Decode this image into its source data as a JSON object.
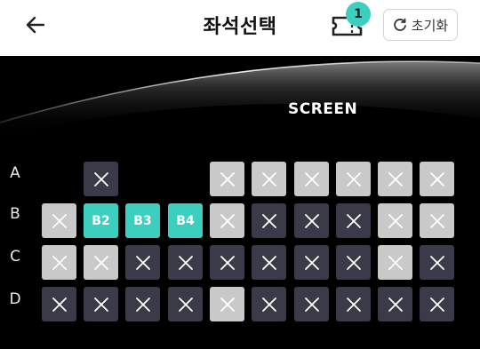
{
  "header": {
    "title": "좌석선택",
    "ticket_count": "1",
    "reset_label": "초기화"
  },
  "screen": {
    "label": "SCREEN"
  },
  "rows": [
    {
      "label": "A",
      "seats": [
        "empty",
        "dark",
        "empty",
        "empty",
        "light",
        "light",
        "light",
        "light",
        "light",
        "light"
      ]
    },
    {
      "label": "B",
      "seats": [
        "light",
        "B2",
        "B3",
        "B4",
        "light",
        "dark",
        "dark",
        "dark",
        "light",
        "light"
      ]
    },
    {
      "label": "C",
      "seats": [
        "light",
        "light",
        "dark",
        "dark",
        "dark",
        "dark",
        "dark",
        "dark",
        "light",
        "dark"
      ]
    },
    {
      "label": "D",
      "seats": [
        "dark",
        "dark",
        "dark",
        "dark",
        "light",
        "dark",
        "dark",
        "dark",
        "dark",
        "dark"
      ]
    }
  ],
  "colors": {
    "selected": "#3ccfc0",
    "unavailable_dark": "#3a3a48",
    "unavailable_light": "#c9c9c9"
  },
  "icons": {
    "back": "arrow-left-icon",
    "ticket": "ticket-icon",
    "reset": "refresh-icon",
    "unavailable": "close-icon"
  }
}
